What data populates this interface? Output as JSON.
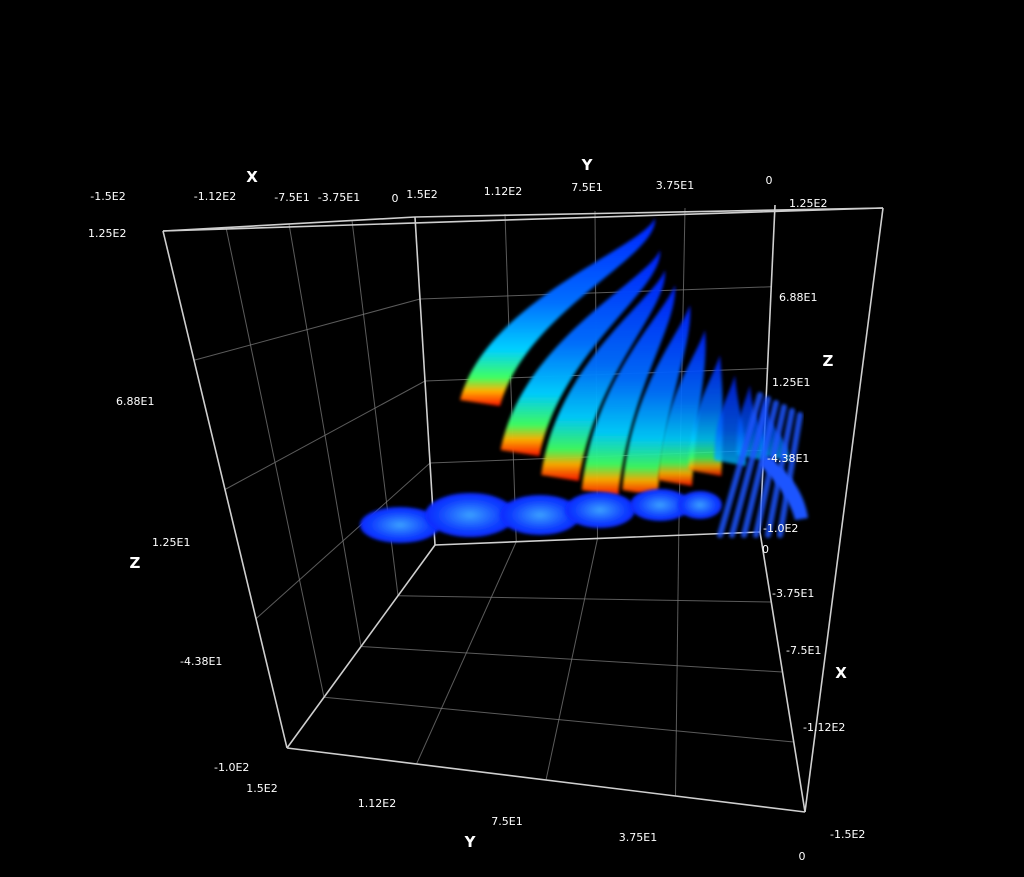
{
  "chart_data": {
    "type": "surface3d",
    "title": "",
    "axes": {
      "x": {
        "name": "X",
        "ticks": [
          "-1.5E2",
          "-1.12E2",
          "-7.5E1",
          "-3.75E1",
          "0"
        ],
        "range": [
          -150,
          0
        ]
      },
      "y": {
        "name": "Y",
        "ticks": [
          "1.5E2",
          "1.12E2",
          "7.5E1",
          "3.75E1",
          "0"
        ],
        "range": [
          0,
          150
        ]
      },
      "z": {
        "name": "Z",
        "ticks": [
          "1.25E2",
          "6.88E1",
          "1.25E1",
          "-4.38E1",
          "-1.0E2"
        ],
        "range": [
          -100,
          125
        ]
      }
    },
    "grid": true,
    "colormap": [
      "#0000ff",
      "#0080ff",
      "#00e0ff",
      "#40ff80",
      "#ffff00",
      "#ff8000",
      "#ff0000"
    ],
    "background": "#000000",
    "bands": [
      {
        "level": 1.0
      },
      {
        "level": 0.95
      },
      {
        "level": 0.9
      },
      {
        "level": 0.92
      },
      {
        "level": 0.88
      },
      {
        "level": 0.82
      },
      {
        "level": 0.7
      },
      {
        "level": 0.55
      },
      {
        "level": 0.45
      },
      {
        "level": 0.35
      }
    ]
  }
}
